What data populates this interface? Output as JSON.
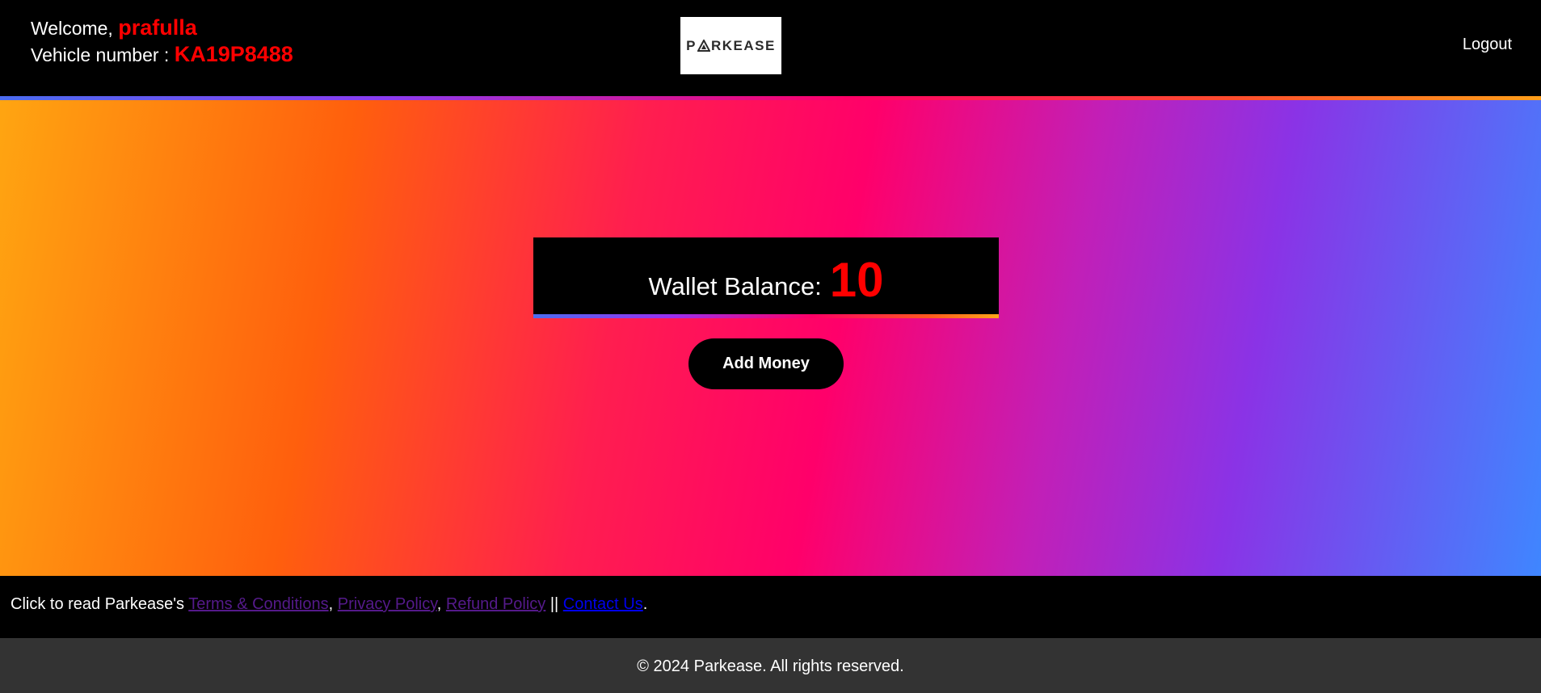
{
  "header": {
    "welcome_prefix": "Welcome, ",
    "username": "prafulla",
    "vehicle_prefix": "Vehicle number : ",
    "vehicle_number": "KA19P8488",
    "logo_text_start": "P",
    "logo_text_end": "RKEASE",
    "logout_label": "Logout"
  },
  "wallet": {
    "label": "Wallet Balance:",
    "balance": "10"
  },
  "actions": {
    "add_money_label": "Add Money"
  },
  "links_bar": {
    "prefix": "Click to read Parkease's ",
    "terms": "Terms & Conditions",
    "sep1": ", ",
    "privacy": "Privacy Policy",
    "sep2": ", ",
    "refund": "Refund Policy",
    "sep3": " || ",
    "contact": "Contact Us",
    "suffix": "."
  },
  "footer": {
    "copyright": "© 2024 Parkease. All rights reserved."
  },
  "colors": {
    "accent": "#ff0000",
    "visited_link": "#551a8b",
    "link": "#0000ee",
    "footer_bg": "#333333"
  }
}
